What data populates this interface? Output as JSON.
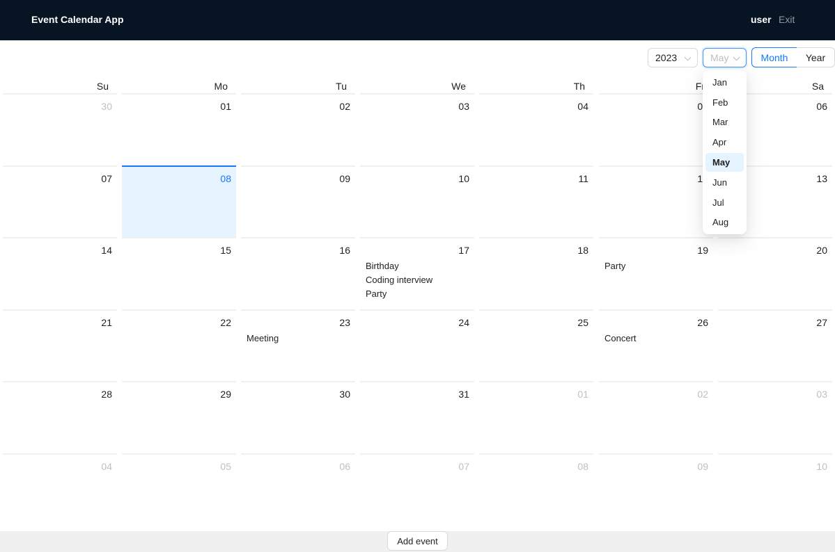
{
  "header": {
    "title": "Event Calendar App",
    "user": "user",
    "exit_label": "Exit"
  },
  "controls": {
    "year_value": "2023",
    "month_value": "May",
    "mode_month_label": "Month",
    "mode_year_label": "Year",
    "active_mode": "Month"
  },
  "month_dropdown": {
    "options": [
      "Jan",
      "Feb",
      "Mar",
      "Apr",
      "May",
      "Jun",
      "Jul",
      "Aug"
    ],
    "selected": "May"
  },
  "weekdays": [
    "Su",
    "Mo",
    "Tu",
    "We",
    "Th",
    "Fr",
    "Sa"
  ],
  "calendar": {
    "today": "08",
    "weeks": [
      [
        {
          "day": "30",
          "other": true,
          "events": []
        },
        {
          "day": "01",
          "events": []
        },
        {
          "day": "02",
          "events": []
        },
        {
          "day": "03",
          "events": []
        },
        {
          "day": "04",
          "events": []
        },
        {
          "day": "05",
          "events": []
        },
        {
          "day": "06",
          "events": []
        }
      ],
      [
        {
          "day": "07",
          "events": []
        },
        {
          "day": "08",
          "today": true,
          "events": []
        },
        {
          "day": "09",
          "events": []
        },
        {
          "day": "10",
          "events": []
        },
        {
          "day": "11",
          "events": []
        },
        {
          "day": "12",
          "events": []
        },
        {
          "day": "13",
          "events": []
        }
      ],
      [
        {
          "day": "14",
          "events": []
        },
        {
          "day": "15",
          "events": []
        },
        {
          "day": "16",
          "events": []
        },
        {
          "day": "17",
          "events": [
            "Birthday",
            "Coding interview",
            "Party"
          ]
        },
        {
          "day": "18",
          "events": []
        },
        {
          "day": "19",
          "events": [
            "Party"
          ]
        },
        {
          "day": "20",
          "events": []
        }
      ],
      [
        {
          "day": "21",
          "events": []
        },
        {
          "day": "22",
          "events": []
        },
        {
          "day": "23",
          "events": [
            "Meeting"
          ]
        },
        {
          "day": "24",
          "events": []
        },
        {
          "day": "25",
          "events": []
        },
        {
          "day": "26",
          "events": [
            "Concert"
          ]
        },
        {
          "day": "27",
          "events": []
        }
      ],
      [
        {
          "day": "28",
          "events": []
        },
        {
          "day": "29",
          "events": []
        },
        {
          "day": "30",
          "events": []
        },
        {
          "day": "31",
          "events": []
        },
        {
          "day": "01",
          "other": true,
          "events": []
        },
        {
          "day": "02",
          "other": true,
          "events": []
        },
        {
          "day": "03",
          "other": true,
          "events": []
        }
      ],
      [
        {
          "day": "04",
          "other": true,
          "events": []
        },
        {
          "day": "05",
          "other": true,
          "events": []
        },
        {
          "day": "06",
          "other": true,
          "events": []
        },
        {
          "day": "07",
          "other": true,
          "events": []
        },
        {
          "day": "08",
          "other": true,
          "events": []
        },
        {
          "day": "09",
          "other": true,
          "events": []
        },
        {
          "day": "10",
          "other": true,
          "events": []
        }
      ]
    ]
  },
  "footer": {
    "add_event_label": "Add event"
  },
  "colors": {
    "header_bg": "#061423",
    "accent": "#1677ff",
    "today_bg": "#e6f4ff",
    "footer_bg": "#f0f0f0"
  }
}
